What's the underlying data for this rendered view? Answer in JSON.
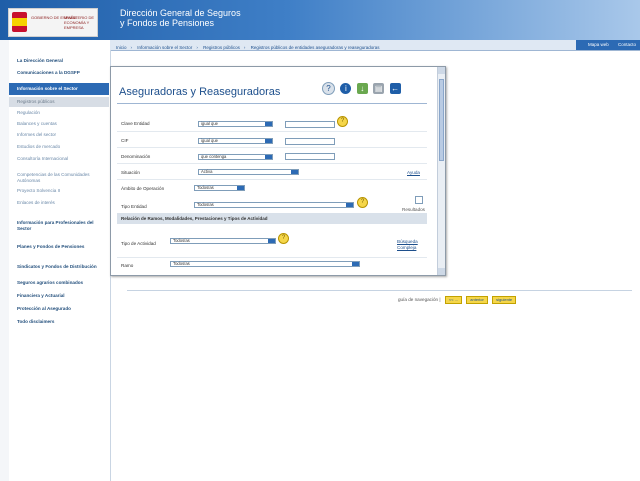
{
  "header": {
    "logo_left": "GOBIERNO DE ESPAÑA",
    "logo_right": "MINISTERIO DE ECONOMÍA Y EMPRESA",
    "title_line1": "Dirección General de Seguros",
    "title_line2": "y Fondos de Pensiones"
  },
  "topbar": {
    "links": [
      "Mapa web",
      "Contacto"
    ]
  },
  "breadcrumb": [
    "Inicio",
    "Información sobre el Sector",
    "Registros públicos",
    "Registros públicos de entidades aseguradoras y reaseguradoras"
  ],
  "sidebar": {
    "items": [
      {
        "label": "La Dirección General",
        "style": "bold"
      },
      {
        "label": "Comunicaciones a la DGSFP",
        "style": "bold"
      },
      {
        "label": "Información sobre el Sector",
        "style": "active"
      },
      {
        "label": "Registros públicos",
        "style": "grey"
      },
      {
        "label": "Regulación",
        "style": "sub"
      },
      {
        "label": "Balances y cuentas",
        "style": "sub"
      },
      {
        "label": "Informes del sector",
        "style": "sub"
      },
      {
        "label": "Estudios de mercado",
        "style": "sub"
      },
      {
        "label": "Consultoría Internacional",
        "style": "sub"
      },
      {
        "label": "Competencias de las Comunidades Autónomas",
        "style": "sub"
      },
      {
        "label": "Proyecto Solvencia II",
        "style": "sub"
      },
      {
        "label": "Enlaces de interés",
        "style": "sub"
      },
      {
        "label": "Información para Profesionales del Sector",
        "style": "bold"
      },
      {
        "label": "Planes y Fondos de Pensiones",
        "style": "bold"
      },
      {
        "label": "Sindicatos y Fondos de Distribución",
        "style": "bold"
      },
      {
        "label": "Seguros agrarios combinados",
        "style": "bold"
      },
      {
        "label": "Financiera y Actuarial",
        "style": "bold"
      },
      {
        "label": "Protección al Asegurado",
        "style": "bold"
      },
      {
        "label": "Todo disclaimers",
        "style": "bold"
      }
    ]
  },
  "panel": {
    "title": "Aseguradoras y Reaseguradoras",
    "fields": {
      "clave_label": "Clave Entidad",
      "clave_op": "igual que",
      "cif_label": "CIF",
      "cif_op": "igual que",
      "denominacion_label": "Denominación",
      "denominacion_op": "que contenga",
      "situacion_label": "Situación",
      "situacion_value": "Activa",
      "ambito_label": "Ámbito de Operación",
      "ambito_value": "Todos/as",
      "tipo_label": "Tipo Entidad",
      "tipo_value": "Todos/as",
      "section_title": "Relación de Ramos, Modalidades, Prestaciones y Tipos de Actividad",
      "actividad_label": "Tipo de Actividad",
      "actividad_value": "Todos/as",
      "ramo_label": "Ramo",
      "ramo_value": "Todos/as"
    },
    "links": {
      "ayuda": "Ayuda",
      "resultados": "Resultados",
      "busqueda": "Búsqueda Compleja"
    }
  },
  "nav": {
    "label": "guía de navegación",
    "buttons": [
      "<< ...",
      "anterior",
      "siguiente"
    ]
  },
  "colors": {
    "header": "#1f5ea8",
    "accent": "#2c6ab4",
    "help": "#f5d64a"
  }
}
